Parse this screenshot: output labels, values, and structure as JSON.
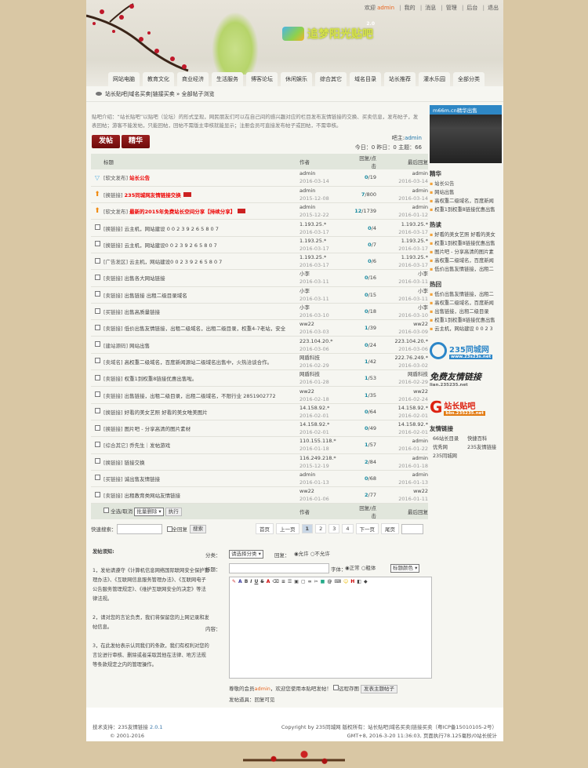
{
  "header": {
    "logo": "追梦阳光贴吧",
    "version": "2.0",
    "welcome": "欢迎",
    "user": "admin",
    "links": [
      "我的",
      "消息",
      "管理",
      "后台",
      "退出"
    ]
  },
  "tabs": [
    "网站电脑",
    "教育文化",
    "商业经济",
    "生活服务",
    "博客论坛",
    "休闲娱乐",
    "综合其它",
    "域名目录",
    "站长推荐",
    "灌水乐园",
    "全部分类"
  ],
  "breadcrumb": {
    "forum": "站长贴吧|域名买卖|链接买卖",
    "sep": "»",
    "current": "全部帖子浏览"
  },
  "intro": "贴吧介绍：“站长贴吧”以贴吧（论坛）的形式呈现，网民朋友们可以在自己间的感兴趣对应的栏目发布友情链接的交换、买卖信息，发布帖子，发表回帖；游客不能发帖，只能回帖，回帖不需版主审核就能显示；注册会员可直接发布帖子或回帖，不需审核。",
  "buttons": {
    "post": "发帖",
    "digest": "精华"
  },
  "owner": {
    "label": "吧主:",
    "name": "admin",
    "stats": "今日：0 昨日：0 主题：66"
  },
  "table": {
    "headers": [
      "标题",
      "作者",
      "回复/点击",
      "最后回复"
    ],
    "rows": [
      {
        "icon": "announce",
        "cat": "[软文发布]",
        "title": "站长公告",
        "hot": true,
        "author": "admin",
        "date": "2016-03-14",
        "replies": "0",
        "views": "/19",
        "last": "admin",
        "last_date": "2016-03-14"
      },
      {
        "icon": "top",
        "cat": "[换链接]",
        "title": "235同城网友情链接交换",
        "hot": true,
        "new": true,
        "author": "admin",
        "date": "2015-12-08",
        "replies": "7",
        "views": "/800",
        "last": "admin",
        "last_date": "2016-03-14"
      },
      {
        "icon": "top",
        "cat": "[软文发布]",
        "title": "最新的2015年免费站长空间分享【持续分享】",
        "hot": true,
        "new": true,
        "author": "admin",
        "date": "2015-12-22",
        "replies": "12",
        "views": "/1739",
        "last": "admin",
        "last_date": "2016-01-12"
      },
      {
        "icon": "cb",
        "cat": "[换链接]",
        "title": "云主机，网站建设 0 0 2 3 9 2 6 5 8 0 7",
        "author": "1.193.25.*",
        "date": "2016-03-17",
        "replies": "0",
        "views": "/4",
        "last": "1.193.25.*",
        "last_date": "2016-03-17"
      },
      {
        "icon": "cb",
        "cat": "[换链接]",
        "title": "云主机，网站建设0 0 2 3 9 2 6 5 8 0 7",
        "author": "1.193.25.*",
        "date": "2016-03-17",
        "replies": "0",
        "views": "/7",
        "last": "1.193.25.*",
        "last_date": "2016-03-17"
      },
      {
        "icon": "cb",
        "cat": "[广告发区]",
        "title": "云主机，网站建设0 0 2 3 9 2 6 5 8 0 7",
        "author": "1.193.25.*",
        "date": "2016-03-17",
        "replies": "0",
        "views": "/6",
        "last": "1.193.25.*",
        "last_date": "2016-03-17"
      },
      {
        "icon": "cb",
        "cat": "[卖链接]",
        "title": "出售各大网站链接",
        "author": "小李",
        "date": "2016-03-11",
        "replies": "0",
        "views": "/16",
        "last": "小李",
        "last_date": "2016-03-11"
      },
      {
        "icon": "cb",
        "cat": "[卖链接]",
        "title": "出售链接 出租二级目录域名",
        "author": "小李",
        "date": "2016-03-11",
        "replies": "0",
        "views": "/15",
        "last": "小李",
        "last_date": "2016-03-11"
      },
      {
        "icon": "cb",
        "cat": "[买链接]",
        "title": "出售高质量链接",
        "author": "小李",
        "date": "2016-03-10",
        "replies": "0",
        "views": "/18",
        "last": "小李",
        "last_date": "2016-03-10"
      },
      {
        "icon": "cb",
        "cat": "[卖链接]",
        "title": "低价出售友情链接，出租二级域名，出租二级目录，权重4-7老站，安全",
        "author": "ww22",
        "date": "2016-03-03",
        "replies": "1",
        "views": "/39",
        "last": "ww22",
        "last_date": "2016-03-09"
      },
      {
        "icon": "cb",
        "cat": "[建站源码]",
        "title": "网站出售",
        "author": "223.104.20.*",
        "date": "2016-03-06",
        "replies": "0",
        "views": "/24",
        "last": "223.104.20.*",
        "last_date": "2016-03-06"
      },
      {
        "icon": "cb",
        "cat": "[卖域名]",
        "title": "高权重二级域名，百度新闻源站二级域名出售中，火热洽谈合作。",
        "author": "网盾科技",
        "date": "2016-02-29",
        "replies": "1",
        "views": "/42",
        "last": "222.76.249.*",
        "last_date": "2016-03-02"
      },
      {
        "icon": "cb",
        "cat": "[卖链接]",
        "title": "权重1到权重8链接优惠出售啦。",
        "author": "网盾科技",
        "date": "2016-01-28",
        "replies": "1",
        "views": "/53",
        "last": "网盾科技",
        "last_date": "2016-02-29"
      },
      {
        "icon": "cb",
        "cat": "[卖链接]",
        "title": "出售链接，出租二级目录，出租二级域名，不限行业 2851902772",
        "author": "ww22",
        "date": "2016-02-18",
        "replies": "1",
        "views": "/35",
        "last": "ww22",
        "last_date": "2016-02-24"
      },
      {
        "icon": "cb",
        "cat": "[换链接]",
        "title": "好看的美女艺照 好看的美女唯美图片",
        "author": "14.158.92.*",
        "date": "2016-02-01",
        "replies": "0",
        "views": "/64",
        "last": "14.158.92.*",
        "last_date": "2016-02-01"
      },
      {
        "icon": "cb",
        "cat": "[换链接]",
        "title": "图片吧 - 分享高清的图片素材",
        "author": "14.158.92.*",
        "date": "2016-02-01",
        "replies": "0",
        "views": "/49",
        "last": "14.158.92.*",
        "last_date": "2016-02-01"
      },
      {
        "icon": "cb",
        "cat": "[综合其它]",
        "title": "乔先生｜发帖游戏",
        "author": "110.155.118.*",
        "date": "2016-01-18",
        "replies": "1",
        "views": "/57",
        "last": "admin",
        "last_date": "2016-01-22"
      },
      {
        "icon": "cb",
        "cat": "[换链接]",
        "title": "链接交换",
        "author": "116.249.218.*",
        "date": "2015-12-19",
        "replies": "2",
        "views": "/84",
        "last": "admin",
        "last_date": "2016-01-18"
      },
      {
        "icon": "cb",
        "cat": "[买链接]",
        "title": "诚出售友情链接",
        "author": "admin",
        "date": "2016-01-13",
        "replies": "0",
        "views": "/68",
        "last": "admin",
        "last_date": "2016-01-13"
      },
      {
        "icon": "cb",
        "cat": "[卖链接]",
        "title": "出租教育类网站友情链接",
        "author": "ww22",
        "date": "2016-01-06",
        "replies": "2",
        "views": "/77",
        "last": "ww22",
        "last_date": "2016-01-11"
      }
    ]
  },
  "batch": {
    "select_all": "全选/取消",
    "action": "批量删除",
    "exec": "执行"
  },
  "search": {
    "label": "快速搜索：",
    "full": "全回复",
    "btn": "搜索"
  },
  "pager": {
    "first": "首页",
    "prev": "上一页",
    "pages": [
      "1",
      "2",
      "3",
      "4"
    ],
    "next": "下一页",
    "last": "尾页"
  },
  "sidebar": {
    "photo_caption": "m66m.cn精华出售",
    "digest_title": "精华",
    "digest": [
      "站长公告",
      "网站出售",
      "高权重二级域名，百度新闻",
      "权重1到权重8链接优惠出售"
    ],
    "hotread_title": "热读",
    "hotread": [
      "好看的美女艺照 好看的美女",
      "权重1到权重8链接优惠出售",
      "图片吧 - 分享高清的图片素",
      "高权重二级域名，百度新闻",
      "低价出售友情链接，出租二"
    ],
    "hotreply_title": "热回",
    "hotreply": [
      "低价出售友情链接，出租二",
      "高权重二级域名，百度新闻",
      "出售链接，出租二级目录",
      "权重1到权重8链接优惠出售",
      "云主机，网站建设 0 0 2 3"
    ],
    "ads": [
      {
        "t": "235同城网",
        "s": "www.23s23s.net"
      },
      {
        "t": "免费友情链接",
        "s": "lian.235235.net"
      },
      {
        "t": "站长贴吧",
        "s": "bbs.235235.net"
      }
    ],
    "links_title": "友情链接",
    "links": [
      "66站长目录",
      "快捷百科",
      "优秀网",
      "235友情链接",
      "235同城网"
    ]
  },
  "post": {
    "rules_title": "发帖须知:",
    "rules": [
      "1，发帖请遵守《计算机信息网络国际联网安全保护管理办法》、《互联网信息服务管理办法》、《互联网电子公告服务管理规定》、《维护互联网安全的决定》等法律法规。",
      "2，请对您的言论负责，我们将保留您的上网记录和发帖信息。",
      "3，在此发帖表示认同我们的条款，我们有权利对您的言论进行审核、删除或者采取其他在法律、地方法规等条款规定之内的管理操作。"
    ],
    "cat_label": "分类：",
    "cat_select": "请选择分类",
    "reply_label": "回复：",
    "allow": "允许",
    "deny": "不允许",
    "title_label": "标题：",
    "font_label": "字体：",
    "normal": "正常",
    "bold": "粗体",
    "color_select": "标题颜色",
    "content_label": "内容：",
    "member": "尊敬的会员",
    "user": "admin",
    "welcome_msg": "，欢迎您使用本贴吧发帖！",
    "remote": "远程存图",
    "submit": "发表主题帖子",
    "tools_label": "发帖道具：",
    "tools": "回复可见"
  },
  "footer": {
    "tech": "技术支持：235友情链接",
    "ver": "2.0.1",
    "copy": "© 2001-2016",
    "rights": "Copyright by 235同城网 版权所有：站长贴吧|域名买卖|链接买卖（粤ICP备15010105-2号）",
    "runtime": "GMT+8, 2016-3-20 11:36:03, 页面执行78.125毫秒/0站长统计"
  }
}
